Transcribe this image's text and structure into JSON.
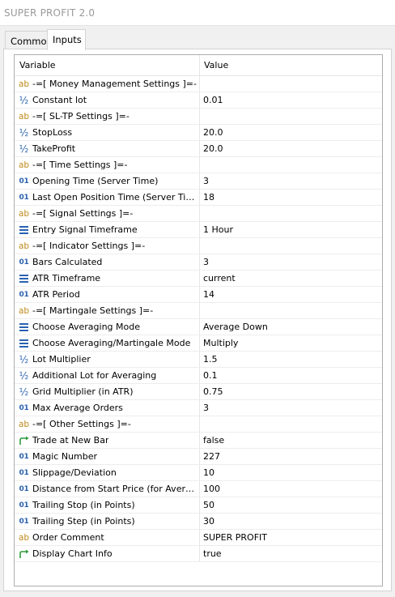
{
  "window": {
    "title": "SUPER PROFIT 2.0"
  },
  "tabs": [
    {
      "label": "Common"
    },
    {
      "label": "Inputs"
    }
  ],
  "table": {
    "headers": {
      "variable": "Variable",
      "value": "Value"
    },
    "rows": [
      {
        "type": "string",
        "icon": "ab-icon",
        "name": "-=[ Money Management Settings ]=-",
        "value": ""
      },
      {
        "type": "double",
        "icon": "fraction-icon",
        "name": "Constant lot",
        "value": "0.01"
      },
      {
        "type": "string",
        "icon": "ab-icon",
        "name": "-=[ SL-TP Settings ]=-",
        "value": ""
      },
      {
        "type": "double",
        "icon": "fraction-icon",
        "name": "StopLoss",
        "value": "20.0"
      },
      {
        "type": "double",
        "icon": "fraction-icon",
        "name": "TakeProfit",
        "value": "20.0"
      },
      {
        "type": "string",
        "icon": "ab-icon",
        "name": "-=[ Time Settings ]=-",
        "value": ""
      },
      {
        "type": "int",
        "icon": "integer-icon",
        "name": "Opening Time (Server Time)",
        "value": "3"
      },
      {
        "type": "int",
        "icon": "integer-icon",
        "name": "Last Open Position Time (Server Time)",
        "value": "18"
      },
      {
        "type": "string",
        "icon": "ab-icon",
        "name": "-=[ Signal Settings ]=-",
        "value": ""
      },
      {
        "type": "enum",
        "icon": "list-icon",
        "name": "Entry Signal Timeframe",
        "value": "1 Hour"
      },
      {
        "type": "string",
        "icon": "ab-icon",
        "name": "-=[ Indicator Settings ]=-",
        "value": ""
      },
      {
        "type": "int",
        "icon": "integer-icon",
        "name": "Bars Calculated",
        "value": "3"
      },
      {
        "type": "enum",
        "icon": "list-icon",
        "name": "ATR Timeframe",
        "value": "current"
      },
      {
        "type": "int",
        "icon": "integer-icon",
        "name": "ATR Period",
        "value": "14"
      },
      {
        "type": "string",
        "icon": "ab-icon",
        "name": "-=[ Martingale Settings ]=-",
        "value": ""
      },
      {
        "type": "enum",
        "icon": "list-icon",
        "name": "Choose Averaging Mode",
        "value": "Average Down"
      },
      {
        "type": "enum",
        "icon": "list-icon",
        "name": "Choose Averaging/Martingale Mode",
        "value": "Multiply"
      },
      {
        "type": "double",
        "icon": "fraction-icon",
        "name": "Lot Multiplier",
        "value": "1.5"
      },
      {
        "type": "double",
        "icon": "fraction-icon",
        "name": "Additional Lot for Averaging",
        "value": "0.1"
      },
      {
        "type": "double",
        "icon": "fraction-icon",
        "name": "Grid Multiplier (in ATR)",
        "value": "0.75"
      },
      {
        "type": "int",
        "icon": "integer-icon",
        "name": "Max Average Orders",
        "value": "3"
      },
      {
        "type": "string",
        "icon": "ab-icon",
        "name": "-=[ Other Settings ]=-",
        "value": ""
      },
      {
        "type": "bool",
        "icon": "bool-arrow-icon",
        "name": "Trade at New Bar",
        "value": "false"
      },
      {
        "type": "int",
        "icon": "integer-icon",
        "name": "Magic Number",
        "value": "227"
      },
      {
        "type": "int",
        "icon": "integer-icon",
        "name": "Slippage/Deviation",
        "value": "10"
      },
      {
        "type": "int",
        "icon": "integer-icon",
        "name": "Distance from Start Price (for Average ...",
        "value": "100"
      },
      {
        "type": "int",
        "icon": "integer-icon",
        "name": "Trailing Stop (in Points)",
        "value": "50"
      },
      {
        "type": "int",
        "icon": "integer-icon",
        "name": "Trailing Step (in Points)",
        "value": "30"
      },
      {
        "type": "string",
        "icon": "ab-icon",
        "name": "Order Comment",
        "value": "SUPER PROFIT"
      },
      {
        "type": "bool",
        "icon": "bool-arrow-icon",
        "name": "Display Chart Info",
        "value": "true"
      }
    ]
  },
  "colors": {
    "string_icon": "#c08a1c",
    "numeric_icon": "#2a62b0",
    "bool_icon": "#2e9b3a",
    "title_text": "#9a9a9a"
  }
}
